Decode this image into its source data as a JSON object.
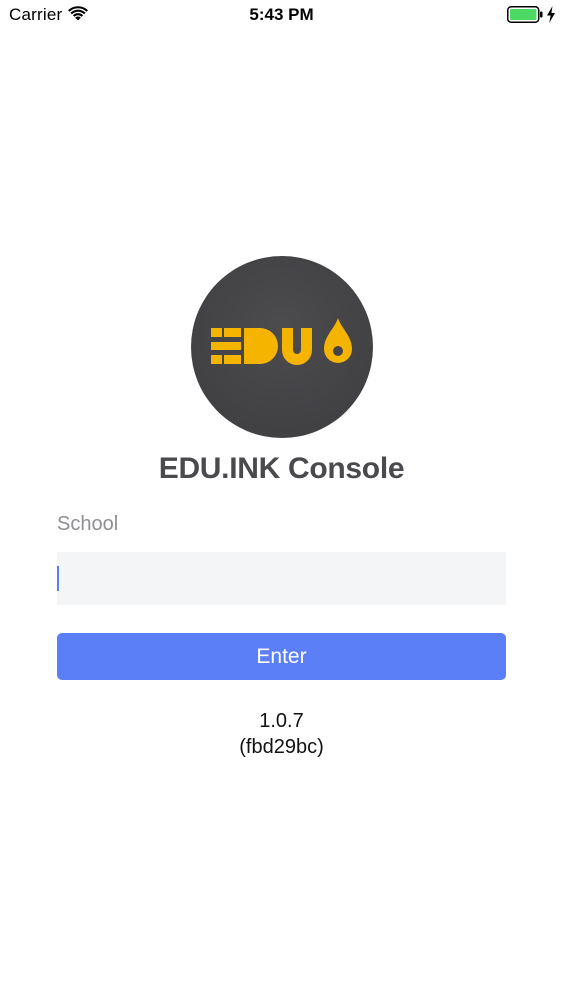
{
  "status_bar": {
    "carrier": "Carrier",
    "time": "5:43 PM",
    "icons": [
      "wifi-icon",
      "battery-icon",
      "charging-icon"
    ],
    "battery_color": "#4cd964"
  },
  "logo": {
    "background": "#444346",
    "glyph_color": "#f5b400"
  },
  "app": {
    "title": "EDU.INK Console"
  },
  "form": {
    "school_label": "School",
    "school_value": "",
    "enter_label": "Enter",
    "button_color": "#5b7ff7"
  },
  "footer": {
    "version": "1.0.7",
    "build": "(fbd29bc)"
  }
}
